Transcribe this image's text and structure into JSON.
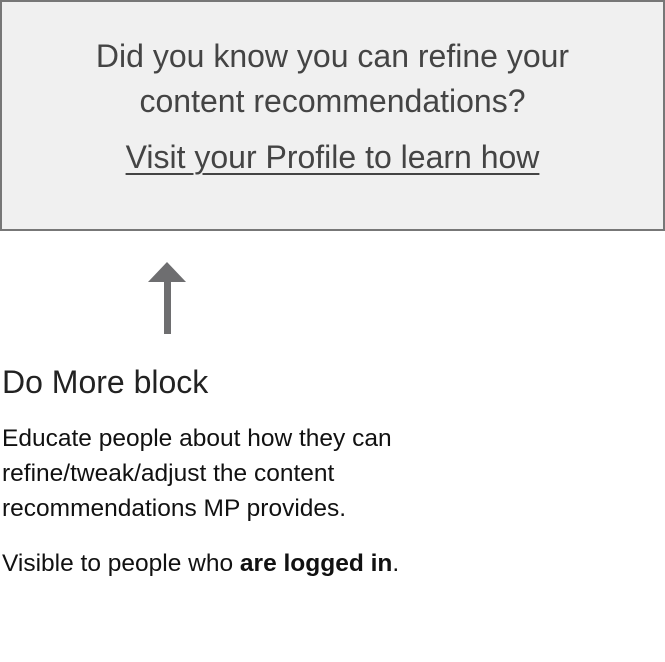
{
  "banner": {
    "question_lines": [
      "Did you know you can refine your",
      "content recommendations?"
    ],
    "link_label": "Visit your Profile to learn how"
  },
  "annotation": {
    "title": "Do More block",
    "description_lines": [
      "Educate people about how they can",
      "refine/tweak/adjust the content",
      "recommendations MP provides."
    ],
    "visibility_prefix": "Visible to people who ",
    "visibility_bold": "are logged in",
    "visibility_suffix": "."
  },
  "colors": {
    "box_bg": "#f0f0f0",
    "border": "#777777",
    "arrow": "#6e6e70"
  }
}
